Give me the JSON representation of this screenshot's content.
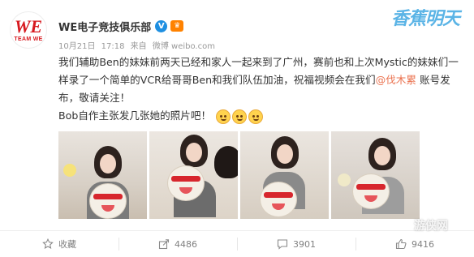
{
  "account": {
    "name": "WE电子竞技俱乐部",
    "avatar_text_main": "WE",
    "avatar_text_sub": "TEAM WE",
    "verified_mark": "V"
  },
  "meta": {
    "date": "10月21日",
    "time": "17:18",
    "source_prefix": "来自",
    "source": "微博 weibo.com"
  },
  "brand": {
    "title": "香蕉明天",
    "subtitle": ""
  },
  "post": {
    "text_before_mention": "我们辅助Ben的妹妹前两天已经和家人一起来到了广州，赛前也和上次Mystic的妹妹们一样录了一个简单的VCR给哥哥Ben和我们队伍加油，祝福视频会在我们",
    "mention": "@伐木累",
    "text_after_mention": " 账号发布，敬请关注！",
    "line2": "Bob自作主张发几张她的照片吧！"
  },
  "photos": [
    {
      "alt": "photo-1"
    },
    {
      "alt": "photo-2"
    },
    {
      "alt": "photo-3"
    },
    {
      "alt": "photo-4"
    }
  ],
  "actions": {
    "favorite_label": "收藏",
    "share_count": "4486",
    "comment_count": "3901",
    "like_count": "9416"
  },
  "watermark": "游侠网",
  "colors": {
    "accent_red": "#d7191f",
    "mention": "#eb7350",
    "verified": "#1e8fe1",
    "meta_text": "#999999"
  },
  "icons": {
    "favorite": "star-icon",
    "share": "share-icon",
    "comment": "comment-icon",
    "like": "thumbs-up-icon",
    "verified": "verified-badge-icon",
    "member": "crown-icon"
  }
}
